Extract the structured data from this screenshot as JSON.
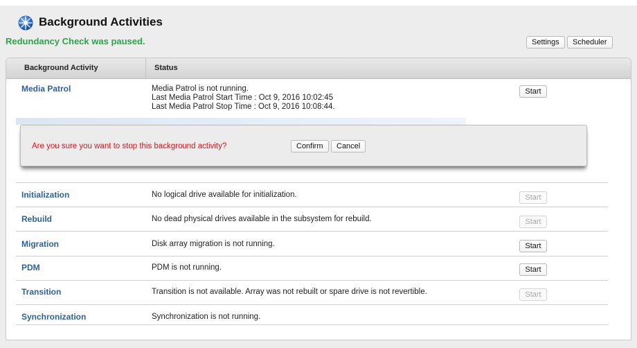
{
  "header": {
    "title": "Background Activities",
    "status_message": "Redundancy Check was paused.",
    "settings_label": "Settings",
    "scheduler_label": "Scheduler"
  },
  "table": {
    "columns": [
      "Background Activity",
      "Status"
    ],
    "media_patrol": {
      "name": "Media Patrol",
      "status_lines": [
        "Media Patrol is not running.",
        "Last Media Patrol Start Time : Oct 9, 2016 10:02:45",
        "Last Media Patrol Stop Time : Oct 9, 2016 10:08:44."
      ],
      "button": "Start"
    },
    "rows": [
      {
        "name": "Initialization",
        "status": "No logical drive available for initialization.",
        "button": "Start",
        "enabled": false
      },
      {
        "name": "Rebuild",
        "status": "No dead physical drives available in the subsystem for rebuild.",
        "button": "Start",
        "enabled": false
      },
      {
        "name": "Migration",
        "status": "Disk array migration is not running.",
        "button": "Start",
        "enabled": true
      },
      {
        "name": "PDM",
        "status": "PDM is not running.",
        "button": "Start",
        "enabled": true
      },
      {
        "name": "Transition",
        "status": "Transition is not available. Array was not rebuilt or spare drive is not revertible.",
        "button": "Start",
        "enabled": false
      },
      {
        "name": "Synchronization",
        "status": "Synchronization is not running.",
        "button": "",
        "enabled": false
      }
    ]
  },
  "dialog": {
    "message": "Are you sure you want to stop this background activity?",
    "confirm_label": "Confirm",
    "cancel_label": "Cancel"
  },
  "icons": {
    "app": "globe-icon"
  },
  "colors": {
    "status_ok": "#2aa54a",
    "link": "#2f6196",
    "warning": "#e0121b"
  }
}
